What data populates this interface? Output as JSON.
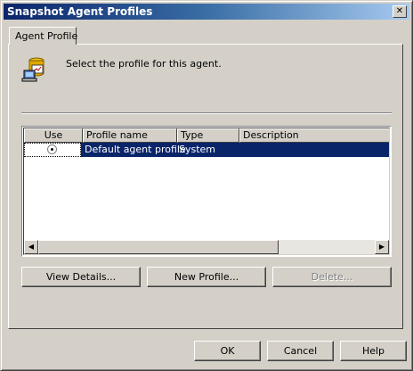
{
  "window": {
    "title": "Snapshot Agent Profiles",
    "close_glyph": "✕"
  },
  "tab": {
    "label": "Agent Profile"
  },
  "prompt": "Select the profile for this agent.",
  "table": {
    "columns": [
      "Use",
      "Profile name",
      "Type",
      "Description"
    ],
    "rows": [
      {
        "use": "selected",
        "profile_name": "Default agent profile",
        "type": "System",
        "description": ""
      }
    ]
  },
  "scrollbar": {
    "left_arrow": "◀",
    "right_arrow": "▶"
  },
  "buttons": {
    "view_details": "View Details...",
    "new_profile": "New Profile...",
    "delete": "Delete...",
    "ok": "OK",
    "cancel": "Cancel",
    "help": "Help"
  },
  "colors": {
    "selection": "#0a246a",
    "face": "#d4d0c8"
  }
}
